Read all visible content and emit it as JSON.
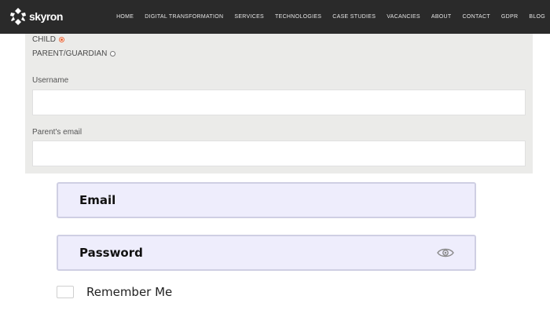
{
  "header": {
    "brand": "skyron",
    "nav": [
      "HOME",
      "DIGITAL TRANSFORMATION",
      "SERVICES",
      "TECHNOLOGIES",
      "CASE STUDIES",
      "VACANCIES",
      "ABOUT",
      "CONTACT",
      "GDPR",
      "BLOG"
    ]
  },
  "form": {
    "radio_child": "CHILD",
    "radio_parent": "PARENT/GUARDIAN",
    "selected_radio": "CHILD",
    "username_label": "Username",
    "username_value": "",
    "parent_email_label": "Parent's email",
    "parent_email_value": ""
  },
  "login": {
    "email_placeholder": "Email",
    "password_placeholder": "Password",
    "remember_label": "Remember Me",
    "remember_checked": false
  },
  "colors": {
    "nav_bg": "#2a2a2a",
    "panel_bg": "#ebebe9",
    "radio_accent": "#e9683a",
    "login_field_bg": "#eeedfc"
  },
  "icons": {
    "logo": "skyron-logo-icon",
    "password_toggle": "eye-icon"
  }
}
